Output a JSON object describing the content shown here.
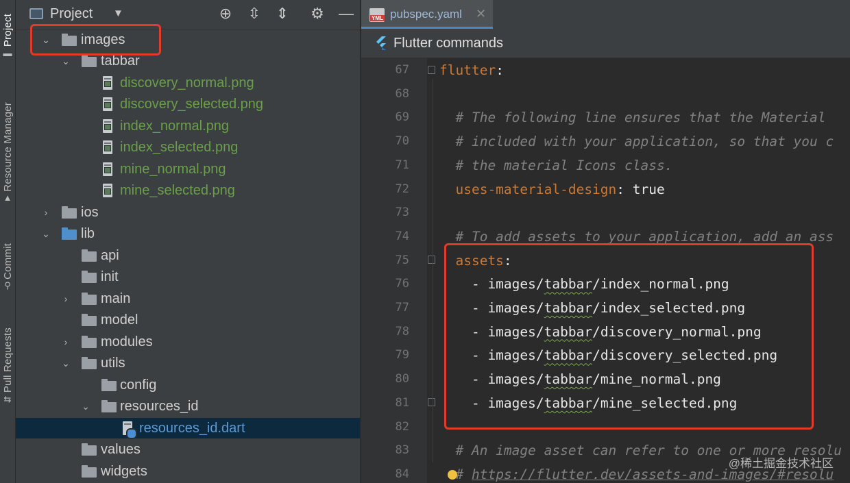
{
  "sidebar_strip": {
    "tabs": [
      {
        "label": "Project",
        "icon": "folder-icon"
      },
      {
        "label": "Resource Manager",
        "icon": "resource-icon"
      },
      {
        "label": "Commit",
        "icon": "commit-icon"
      },
      {
        "label": "Pull Requests",
        "icon": "pull-request-icon"
      }
    ]
  },
  "project_panel": {
    "title": "Project",
    "tools": [
      "locate-icon",
      "expand-all-icon",
      "collapse-all-icon",
      "gear-icon",
      "minimize-icon"
    ],
    "tree": [
      {
        "label": "images",
        "type": "folder",
        "expanded": true,
        "highlighted": true
      },
      {
        "label": "tabbar",
        "type": "folder",
        "expanded": true
      },
      {
        "label": "discovery_normal.png",
        "type": "image-file"
      },
      {
        "label": "discovery_selected.png",
        "type": "image-file"
      },
      {
        "label": "index_normal.png",
        "type": "image-file"
      },
      {
        "label": "index_selected.png",
        "type": "image-file"
      },
      {
        "label": "mine_normal.png",
        "type": "image-file"
      },
      {
        "label": "mine_selected.png",
        "type": "image-file"
      },
      {
        "label": "ios",
        "type": "folder",
        "expanded": false
      },
      {
        "label": "lib",
        "type": "folder",
        "expanded": true
      },
      {
        "label": "api",
        "type": "folder"
      },
      {
        "label": "init",
        "type": "folder"
      },
      {
        "label": "main",
        "type": "folder",
        "expanded": false
      },
      {
        "label": "model",
        "type": "folder"
      },
      {
        "label": "modules",
        "type": "folder",
        "expanded": false
      },
      {
        "label": "utils",
        "type": "folder",
        "expanded": true
      },
      {
        "label": "config",
        "type": "folder"
      },
      {
        "label": "resources_id",
        "type": "folder",
        "expanded": true
      },
      {
        "label": "resources_id.dart",
        "type": "dart-file",
        "selected": true
      },
      {
        "label": "values",
        "type": "folder"
      },
      {
        "label": "widgets",
        "type": "folder"
      }
    ]
  },
  "editor": {
    "tab_label": "pubspec.yaml",
    "tab_badge": "YML",
    "flutter_bar_label": "Flutter commands",
    "lines": [
      {
        "num": "67",
        "parts": [
          {
            "t": "flutter",
            "c": "key"
          },
          {
            "t": ":",
            "c": "val"
          }
        ]
      },
      {
        "num": "68",
        "parts": []
      },
      {
        "num": "69",
        "parts": [
          {
            "t": "  # The following line ensures that the Material",
            "c": "cmt"
          }
        ]
      },
      {
        "num": "70",
        "parts": [
          {
            "t": "  # included with your application, so that you c",
            "c": "cmt"
          }
        ]
      },
      {
        "num": "71",
        "parts": [
          {
            "t": "  # the material Icons class.",
            "c": "cmt"
          }
        ]
      },
      {
        "num": "72",
        "parts": [
          {
            "t": "  uses-material-design",
            "c": "key"
          },
          {
            "t": ": true",
            "c": "val"
          }
        ]
      },
      {
        "num": "73",
        "parts": []
      },
      {
        "num": "74",
        "parts": [
          {
            "t": "  # To add assets to your application, add an ass",
            "c": "cmt"
          }
        ]
      },
      {
        "num": "75",
        "parts": [
          {
            "t": "  assets",
            "c": "key"
          },
          {
            "t": ":",
            "c": "val"
          }
        ]
      },
      {
        "num": "76",
        "parts": [
          {
            "t": "    - images/",
            "c": "val"
          },
          {
            "t": "tabbar",
            "c": "val wavy"
          },
          {
            "t": "/index_normal.png",
            "c": "val"
          }
        ]
      },
      {
        "num": "77",
        "parts": [
          {
            "t": "    - images/",
            "c": "val"
          },
          {
            "t": "tabbar",
            "c": "val wavy"
          },
          {
            "t": "/index_selected.png",
            "c": "val"
          }
        ]
      },
      {
        "num": "78",
        "parts": [
          {
            "t": "    - images/",
            "c": "val"
          },
          {
            "t": "tabbar",
            "c": "val wavy"
          },
          {
            "t": "/discovery_normal.png",
            "c": "val"
          }
        ]
      },
      {
        "num": "79",
        "parts": [
          {
            "t": "    - images/",
            "c": "val"
          },
          {
            "t": "tabbar",
            "c": "val wavy"
          },
          {
            "t": "/discovery_selected.png",
            "c": "val"
          }
        ]
      },
      {
        "num": "80",
        "parts": [
          {
            "t": "    - images/",
            "c": "val"
          },
          {
            "t": "tabbar",
            "c": "val wavy"
          },
          {
            "t": "/mine_normal.png",
            "c": "val"
          }
        ]
      },
      {
        "num": "81",
        "parts": [
          {
            "t": "    - images/",
            "c": "val"
          },
          {
            "t": "tabbar",
            "c": "val wavy"
          },
          {
            "t": "/mine_selected.png",
            "c": "val"
          }
        ]
      },
      {
        "num": "82",
        "parts": []
      },
      {
        "num": "83",
        "parts": [
          {
            "t": "  # An image asset can refer to one or more resolu",
            "c": "cmt"
          }
        ]
      },
      {
        "num": "84",
        "parts": [
          {
            "t": "  # ",
            "c": "cmt"
          },
          {
            "t": "https://flutter.dev/assets-and-images/#resolu",
            "c": "link"
          }
        ]
      }
    ],
    "watermark": "@稀土掘金技术社区"
  },
  "colors": {
    "highlight_box": "#e03b2b",
    "yaml_key": "#cc7832",
    "comment": "#808080",
    "image_file_text": "#6a9f4a"
  }
}
